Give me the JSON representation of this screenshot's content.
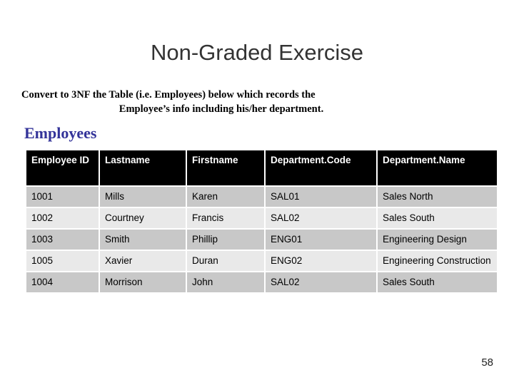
{
  "slide": {
    "title": "Non-Graded Exercise",
    "subtitle_line_1": "Convert to 3NF the Table (i.e. Employees) below which records the",
    "subtitle_line_2": "Employee’s info including his/her department.",
    "section_heading": "Employees",
    "page_number": "58",
    "colors": {
      "title": "#333333",
      "heading": "#333399",
      "header_row_bg": "#000000",
      "header_row_text": "#ffffff",
      "row_dark_bg": "#c8c8c8",
      "row_light_bg": "#e9e9e9",
      "background": "#ffffff"
    }
  },
  "table": {
    "name": "Employees",
    "columns": [
      "Employee ID",
      "Lastname",
      "Firstname",
      "Department.Code",
      "Department.Name"
    ],
    "rows": [
      {
        "employee_id": "1001",
        "lastname": "Mills",
        "firstname": "Karen",
        "department_code": "SAL01",
        "department_name": "Sales North"
      },
      {
        "employee_id": "1002",
        "lastname": "Courtney",
        "firstname": "Francis",
        "department_code": "SAL02",
        "department_name": "Sales South"
      },
      {
        "employee_id": "1003",
        "lastname": "Smith",
        "firstname": "Phillip",
        "department_code": "ENG01",
        "department_name": "Engineering Design"
      },
      {
        "employee_id": "1005",
        "lastname": "Xavier",
        "firstname": "Duran",
        "department_code": "ENG02",
        "department_name": "Engineering Construction"
      },
      {
        "employee_id": "1004",
        "lastname": "Morrison",
        "firstname": "John",
        "department_code": "SAL02",
        "department_name": "Sales South"
      }
    ]
  }
}
